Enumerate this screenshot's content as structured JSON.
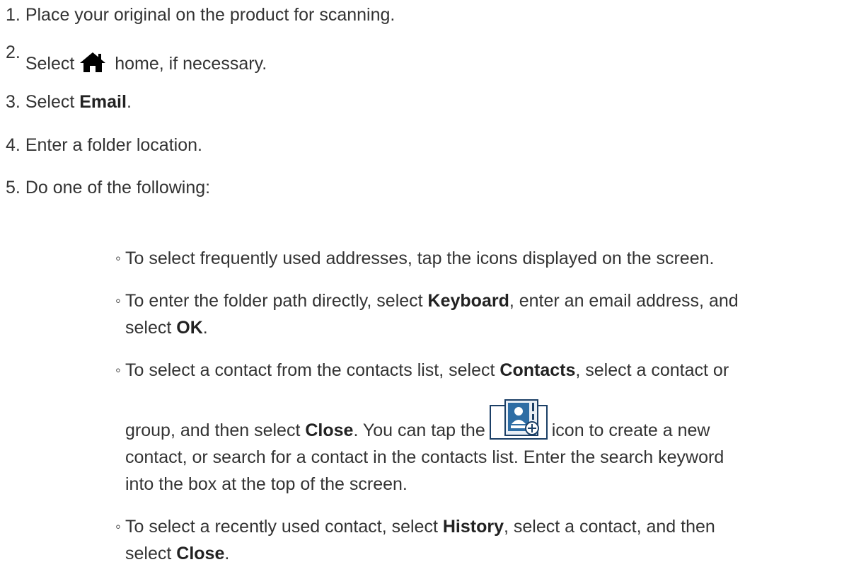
{
  "steps": [
    {
      "number": "1.",
      "text": "Place your original on the product for scanning."
    },
    {
      "number": "2.",
      "before": "Select",
      "icon": "home-icon",
      "after": "home, if necessary."
    },
    {
      "number": "3.",
      "before": "Select ",
      "bold": "Email",
      "after": "."
    },
    {
      "number": "4.",
      "text": "Enter a folder location."
    },
    {
      "number": "5.",
      "text": "Do one of the following:"
    }
  ],
  "bullet": "◦",
  "options": [
    {
      "text": "To select frequently used addresses, tap the icons displayed on the screen."
    },
    {
      "line1_a": "To enter the folder path directly, select ",
      "line1_bold": "Keyboard",
      "line1_b": ", enter an email address, and",
      "line2_a": "select ",
      "line2_bold": "OK",
      "line2_b": "."
    },
    {
      "line1_a": "To select a contact from the contacts list, select ",
      "line1_bold": "Contacts",
      "line1_b": ", select a contact or",
      "line2_a": "group, and then select ",
      "line2_bold": "Close",
      "line2_b": ". You can tap the",
      "icon": "add-contact-icon",
      "line2_c": "icon to create a new",
      "line3": "contact, or search for a contact in the contacts list. Enter the search keyword",
      "line4": "into the box at the top of the screen."
    },
    {
      "line1_a": "To select a recently used contact, select ",
      "line1_bold": "History",
      "line1_b": ", select a contact, and then",
      "line2_a": "select ",
      "line2_bold": "Close",
      "line2_b": "."
    }
  ],
  "colors": {
    "text": "#333333",
    "icon_blue": "#2e6da4",
    "icon_border": "#1b3f66"
  }
}
